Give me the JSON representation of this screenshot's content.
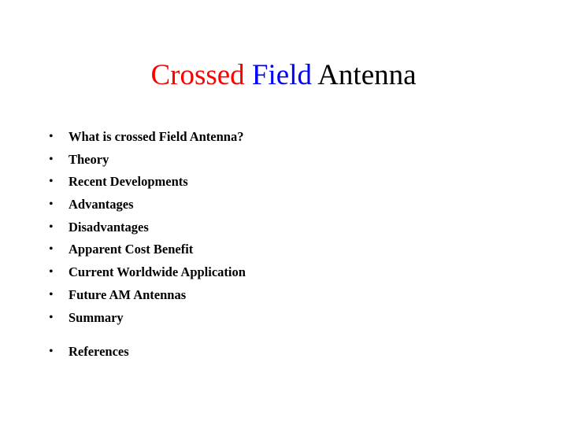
{
  "slide": {
    "background_color": "#ffffff",
    "title": {
      "parts": [
        {
          "text": "Crossed",
          "color": "#ff0000"
        },
        {
          "text": "Field",
          "color": "#0000ff"
        },
        {
          "text": "Antenna",
          "color": "#000000"
        }
      ],
      "full_text": "Crossed Field Antenna"
    },
    "bullet_char": "•",
    "items": [
      {
        "label": "What is crossed Field Antenna?",
        "gap_before": false
      },
      {
        "label": "Theory",
        "gap_before": false
      },
      {
        "label": "Recent Developments",
        "gap_before": false
      },
      {
        "label": "Advantages",
        "gap_before": false
      },
      {
        "label": "Disadvantages",
        "gap_before": false
      },
      {
        "label": "Apparent Cost Benefit",
        "gap_before": false
      },
      {
        "label": "Current Worldwide Application",
        "gap_before": false
      },
      {
        "label": "Future AM Antennas",
        "gap_before": false
      },
      {
        "label": "Summary",
        "gap_before": false
      },
      {
        "label": "References",
        "gap_before": true
      }
    ]
  }
}
